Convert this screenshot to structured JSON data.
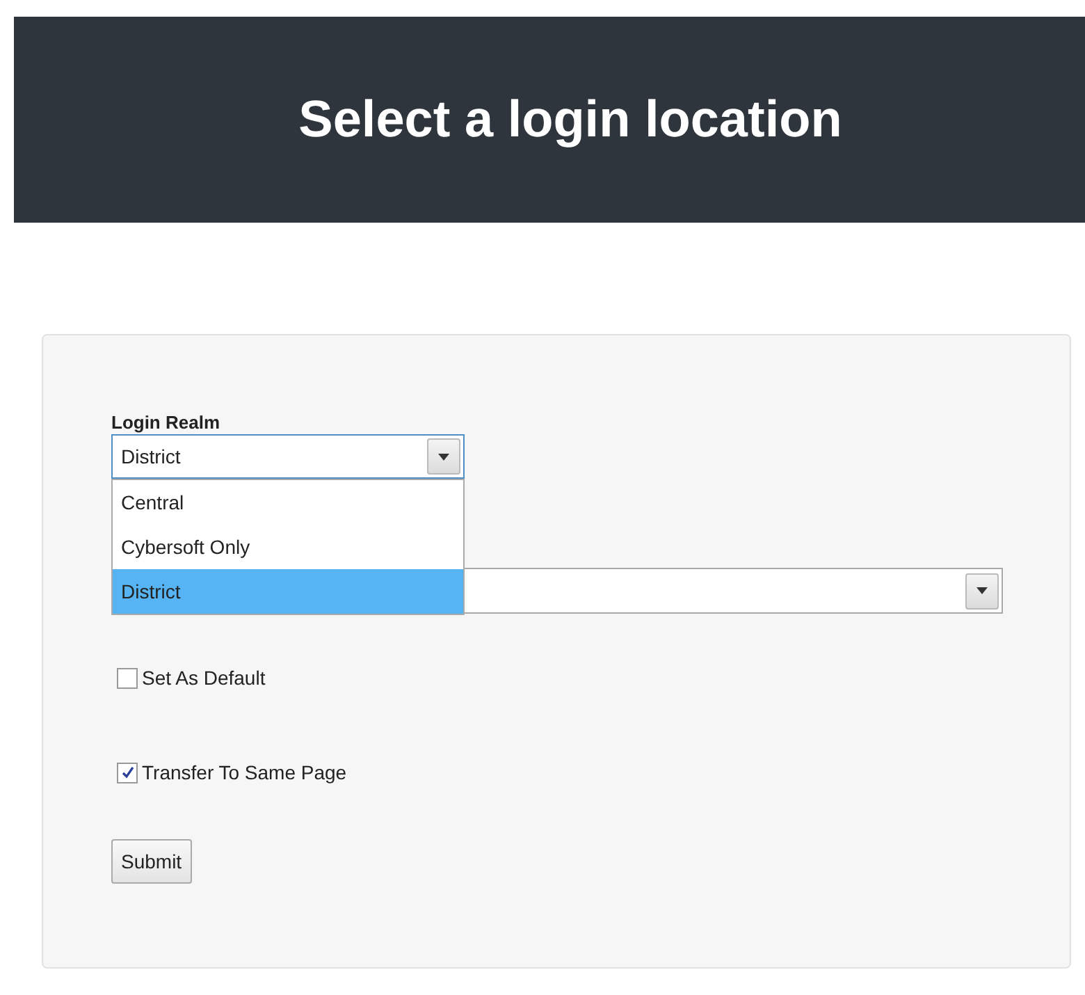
{
  "header": {
    "title": "Select a login location"
  },
  "selects": [
    {
      "label": "Login Realm",
      "value": "District",
      "open": true,
      "options": [
        {
          "label": "Central",
          "selected": false
        },
        {
          "label": "Cybersoft Only",
          "selected": false
        },
        {
          "label": "District",
          "selected": true
        }
      ]
    },
    {
      "open": false
    }
  ],
  "checkboxes": [
    {
      "label": "Set As Default",
      "checked": false
    },
    {
      "label": "Transfer To Same Page",
      "checked": true
    }
  ],
  "submit": {
    "label": "Submit"
  }
}
